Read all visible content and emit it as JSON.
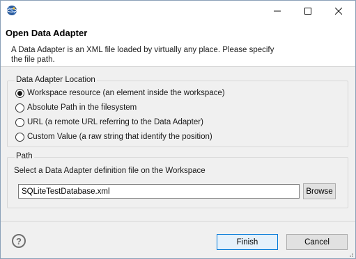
{
  "window": {
    "icon": "eclipse-app-icon",
    "controls": [
      "minimize-icon",
      "maximize-icon",
      "close-icon"
    ]
  },
  "header": {
    "title": "Open Data Adapter",
    "description": "A Data Adapter is an XML file loaded by virtually any place. Please specify the file path."
  },
  "location": {
    "label": "Data Adapter Location",
    "options": [
      {
        "label": "Workspace resource (an element inside the workspace)",
        "checked": true
      },
      {
        "label": "Absolute Path in the filesystem",
        "checked": false
      },
      {
        "label": "URL (a remote URL referring to the Data Adapter)",
        "checked": false
      },
      {
        "label": "Custom Value (a raw string that identify the position)",
        "checked": false
      }
    ]
  },
  "path": {
    "label": "Path",
    "hint": "Select a Data Adapter definition file on the Workspace",
    "value": "SQLiteTestDatabase.xml",
    "browse_label": "Browse"
  },
  "footer": {
    "help_icon": "help-icon",
    "help_glyph": "?",
    "finish_label": "Finish",
    "cancel_label": "Cancel"
  },
  "colors": {
    "accent": "#0078d7",
    "dialog_bg": "#f0f0f0",
    "header_bg": "#ffffff"
  }
}
